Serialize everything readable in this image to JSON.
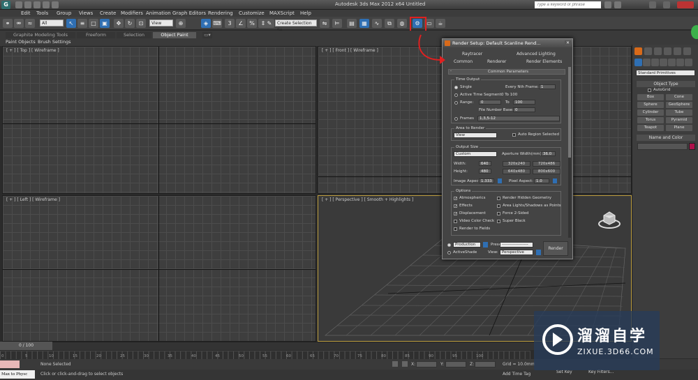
{
  "window": {
    "title": "Autodesk 3ds Max  2012 x64      Untitled",
    "search_placeholder": "Type a keyword or phrase"
  },
  "menu": [
    "Edit",
    "Tools",
    "Group",
    "Views",
    "Create",
    "Modifiers",
    "Animation",
    "Graph Editors",
    "Rendering",
    "Customize",
    "MAXScript",
    "Help"
  ],
  "toolbar": {
    "filter_value": "All",
    "refcoord_value": "View",
    "selection_set_value": "Create Selection Se"
  },
  "ribbon": {
    "tabs": [
      "Graphite Modeling Tools",
      "Freeform",
      "Selection",
      "Object Paint"
    ],
    "active_tab": "Object Paint",
    "subtabs": [
      "Paint Objects",
      "Brush Settings"
    ]
  },
  "viewports": {
    "top_label": "[ + ] [ Top ] [ Wireframe ]",
    "front_label": "[ + ] [ Front ] [ Wireframe ]",
    "left_label": "[ + ] [ Left ] [ Wireframe ]",
    "persp_label": "[ + ] [ Perspective ] [ Smooth + Highlights ]"
  },
  "command_panel": {
    "dropdown": "Standard Primitives",
    "object_type_title": "Object Type",
    "autogrid": "AutoGrid",
    "buttons": [
      "Box",
      "Cone",
      "Sphere",
      "GeoSphere",
      "Cylinder",
      "Tube",
      "Torus",
      "Pyramid",
      "Teapot",
      "Plane"
    ],
    "name_color_title": "Name and Color",
    "color": "#b0104a"
  },
  "dialog": {
    "title": "Render Setup: Default Scanline Rend...",
    "tabs_row1": [
      "Raytracer",
      "Advanced Lighting"
    ],
    "tabs_row2": [
      "Common",
      "Renderer",
      "Render Elements"
    ],
    "rollout": "Common Parameters",
    "time_output": {
      "title": "Time Output",
      "single": "Single",
      "every_nth": "Every Nth Frame:",
      "every_nth_value": "1",
      "active_segment": "Active Time Segment:",
      "active_segment_value": "0 To 100",
      "range": "Range:",
      "range_from": "0",
      "range_to_label": "To",
      "range_to": "100",
      "file_number_base": "File Number Base:",
      "file_number_base_value": "0",
      "frames": "Frames",
      "frames_value": "1,3,5-12"
    },
    "area": {
      "title": "Area to Render",
      "value": "View",
      "auto_region": "Auto Region Selected"
    },
    "output_size": {
      "title": "Output Size",
      "preset": "Custom",
      "aperture_label": "Aperture Width(mm):",
      "aperture_value": "36.0",
      "width_label": "Width:",
      "width_value": "640",
      "height_label": "Height:",
      "height_value": "480",
      "presets": [
        "320x240",
        "720x486",
        "640x480",
        "800x600"
      ],
      "image_aspect_label": "Image Aspect:",
      "image_aspect_value": "1.333",
      "pixel_aspect_label": "Pixel Aspect:",
      "pixel_aspect_value": "1.0"
    },
    "options": {
      "title": "Options",
      "left": [
        {
          "label": "Atmospherics",
          "checked": true
        },
        {
          "label": "Effects",
          "checked": true
        },
        {
          "label": "Displacement",
          "checked": true
        },
        {
          "label": "Video Color Check",
          "checked": false
        },
        {
          "label": "Render to Fields",
          "checked": false
        }
      ],
      "right": [
        {
          "label": "Render Hidden Geometry",
          "checked": false
        },
        {
          "label": "Area Lights/Shadows as Points",
          "checked": false
        },
        {
          "label": "Force 2-Sided",
          "checked": false
        },
        {
          "label": "Super Black",
          "checked": false
        }
      ]
    },
    "bottom": {
      "mode_value": "Production",
      "preset_label": "Preset:",
      "preset_value": "-------------------",
      "activeshade": "ActiveShade",
      "view_label": "View:",
      "view_value": "Perspective",
      "render_button": "Render"
    }
  },
  "timeline": {
    "slider": "0 / 100",
    "ticks": [
      "0",
      "5",
      "10",
      "15",
      "20",
      "25",
      "30",
      "35",
      "40",
      "45",
      "50",
      "55",
      "60",
      "65",
      "70",
      "75",
      "80",
      "85",
      "90",
      "95",
      "100"
    ]
  },
  "status": {
    "script_listener": "Max to Physc",
    "none_selected": "None Selected",
    "prompt": "Click or click-and-drag to select objects",
    "x_label": "X:",
    "y_label": "Y:",
    "z_label": "Z:",
    "grid": "Grid = 10.0mm",
    "add_time_tag": "Add Time Tag",
    "set_key": "Set Key",
    "key_filters": "Key Filters..."
  },
  "watermark": {
    "text": "溜溜自学",
    "url": "ZIXUE.3D66.COM"
  }
}
